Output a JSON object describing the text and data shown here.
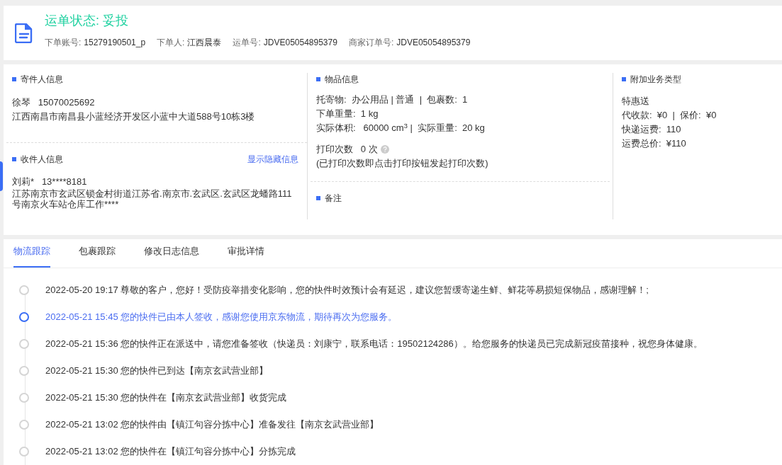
{
  "header": {
    "status": "运单状态: 妥投",
    "fields": [
      {
        "label": "下单账号:",
        "value": "15279190501_p"
      },
      {
        "label": "下单人:",
        "value": "江西晨泰"
      },
      {
        "label": "运单号:",
        "value": "JDVE05054895379"
      },
      {
        "label": "商家订单号:",
        "value": "JDVE05054895379"
      }
    ]
  },
  "sender": {
    "title": "寄件人信息",
    "name_phone": "徐琴   15070025692",
    "address": "江西南昌市南昌县小蓝经济开发区小蓝中大道588号10栋3楼"
  },
  "receiver": {
    "title": "收件人信息",
    "link": "显示隐藏信息",
    "name_phone": "刘莉*   13****8181",
    "address": "江苏南京市玄武区锁金村街道江苏省.南京市.玄武区.玄武区龙蟠路111号南京火车站仓库工作****"
  },
  "goods": {
    "title": "物品信息",
    "lines": [
      "托寄物:  办公用品 | 普通  |  包裹数:  1",
      "下单重量:  1 kg",
      "实际体积:   60000 cm$^{3}$ |  实际重量:  20 kg"
    ],
    "print_count": "打印次数   0 次",
    "print_note": "(已打印次数即点击打印按钮发起打印次数)"
  },
  "remarks": {
    "title": "备注"
  },
  "extra": {
    "title": "附加业务类型",
    "lines": [
      "特惠送",
      "代收款:  ¥0  |  保价:  ¥0",
      "快递运费:  110",
      "运费总价:  ¥110"
    ]
  },
  "tabs": [
    {
      "label": "物流跟踪",
      "selected": true
    },
    {
      "label": "包裹跟踪",
      "selected": false
    },
    {
      "label": "修改日志信息",
      "selected": false
    },
    {
      "label": "审批详情",
      "selected": false
    }
  ],
  "timeline": [
    {
      "text": "2022-05-20 19:17 尊敬的客户，您好！受防疫举措变化影响，您的快件时效预计会有延迟，建议您暂缓寄递生鲜、鲜花等易损短保物品，感谢理解！;",
      "current": false
    },
    {
      "text": "2022-05-21 15:45 您的快件已由本人签收，感谢您使用京东物流，期待再次为您服务。",
      "current": true
    },
    {
      "text": "2022-05-21 15:36 您的快件正在派送中，请您准备签收（快递员：刘康宁，联系电话：19502124286）。给您服务的快递员已完成新冠疫苗接种，祝您身体健康。",
      "current": false
    },
    {
      "text": "2022-05-21 15:30 您的快件已到达【南京玄武营业部】",
      "current": false
    },
    {
      "text": "2022-05-21 15:30 您的快件在【南京玄武营业部】收货完成",
      "current": false
    },
    {
      "text": "2022-05-21 13:02 您的快件由【镇江句容分拣中心】准备发往【南京玄武营业部】",
      "current": false
    },
    {
      "text": "2022-05-21 13:02 您的快件在【镇江句容分拣中心】分拣完成",
      "current": false
    }
  ]
}
